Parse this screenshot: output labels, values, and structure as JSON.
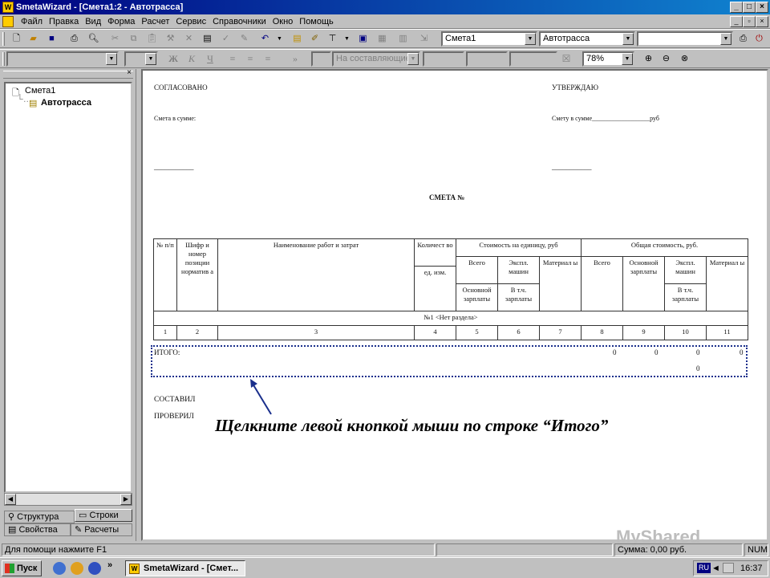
{
  "window": {
    "title": "SmetaWizard - [Смета1:2 - Автотрасса]"
  },
  "menu": [
    "Файл",
    "Правка",
    "Вид",
    "Форма",
    "Расчет",
    "Сервис",
    "Справочники",
    "Окно",
    "Помощь"
  ],
  "toolbar1": {
    "combo1": "Смета1",
    "combo2": "Автотрасса",
    "combo3": ""
  },
  "toolbar2": {
    "bold": "Ж",
    "italic": "К",
    "underline": "Ч",
    "composing": "На составляющие",
    "zoom": "78%"
  },
  "tree": {
    "root": "Смета1",
    "child": "Автотрасса"
  },
  "panel_tabs": {
    "structure": "Структура",
    "rows": "Строки",
    "properties": "Свойства",
    "calculations": "Расчеты"
  },
  "document": {
    "agreed": "СОГЛАСОВАНО",
    "approve": "УТВЕРЖДАЮ",
    "sum_left": "Смета в сумме:",
    "sum_right": "Смету в сумме__________________руб",
    "sign_left": "___________",
    "sign_right": "___________",
    "heading": "СМЕТА №",
    "table": {
      "h_num": "№ п/п",
      "h_code": "Шифр и номер позиции норматив а",
      "h_name": "Наименование работ и затрат",
      "h_qty": "Количест во",
      "h_unit": "ед. изм.",
      "h_unit_cost": "Стоимость на единицу, руб",
      "h_total_cost": "Общая стоимость, руб.",
      "h_all": "Всего",
      "h_machines": "Экспл. машин",
      "h_materials": "Материал ы",
      "h_base_wages": "Основной зарплаты",
      "h_incl_wages": "В т.ч. зарплаты",
      "h_all2": "Всего",
      "h_base_wages2": "Основной зарплаты",
      "h_machines2": "Экспл. машин",
      "h_materials2": "Материал ы",
      "h_incl_wages2": "В т.ч. зарплаты",
      "section": "№1 <Нет раздела>",
      "col_numbers": [
        "1",
        "2",
        "3",
        "4",
        "5",
        "6",
        "7",
        "8",
        "9",
        "10",
        "11"
      ]
    },
    "itogo_label": "ИТОГО:",
    "itogo_values": [
      "0",
      "0",
      "0",
      "0"
    ],
    "itogo_second": "0",
    "compiled": "СОСТАВИЛ",
    "checked": "ПРОВЕРИЛ"
  },
  "callout": "Щелкните левой кнопкой мыши по строке “Итого”",
  "status": {
    "help": "Для помощи нажмите F1",
    "sum": "Сумма: 0,00 руб.",
    "num": "NUM"
  },
  "taskbar": {
    "start": "Пуск",
    "task": "SmetaWizard - [Смет...",
    "lang": "RU",
    "clock": "16:37"
  },
  "watermark": "MyShared",
  "colors": {
    "title_start": "#000080",
    "title_end": "#1084d0",
    "callout_box": "#1a2f8c"
  }
}
